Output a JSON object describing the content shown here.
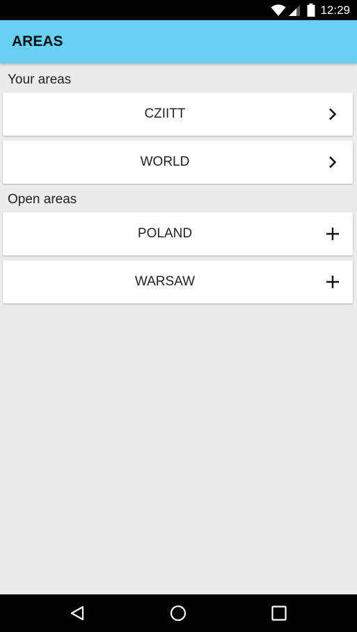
{
  "status_bar": {
    "time": "12:29",
    "icons": [
      "wifi-icon",
      "cell-signal-icon",
      "battery-icon"
    ]
  },
  "app_bar": {
    "title": "AREAS",
    "background_color": "#69cff5"
  },
  "sections": [
    {
      "header": "Your areas",
      "items": [
        {
          "label": "CZIITT",
          "action_icon": "chevron-right-icon"
        },
        {
          "label": "WORLD",
          "action_icon": "chevron-right-icon"
        }
      ]
    },
    {
      "header": "Open areas",
      "items": [
        {
          "label": "POLAND",
          "action_icon": "plus-icon"
        },
        {
          "label": "WARSAW",
          "action_icon": "plus-icon"
        }
      ]
    }
  ],
  "nav_bar": {
    "buttons": [
      "back-icon",
      "home-icon",
      "recents-icon"
    ]
  }
}
